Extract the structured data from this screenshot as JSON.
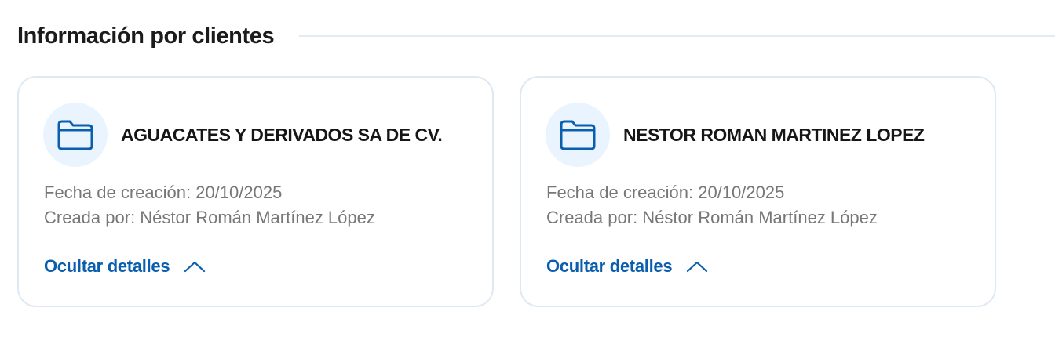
{
  "section": {
    "title": "Información por clientes"
  },
  "cards": [
    {
      "name": "AGUACATES Y DERIVADOS SA DE CV.",
      "created_line": "Fecha de creación: 20/10/2025",
      "author_line": "Creada por: Néstor Román Martínez López",
      "toggle_label": "Ocultar detalles",
      "icon": "folder-icon",
      "toggle_icon": "chevron-up-icon"
    },
    {
      "name": "NESTOR ROMAN MARTINEZ LOPEZ",
      "created_line": "Fecha de creación: 20/10/2025",
      "author_line": "Creada por: Néstor Román Martínez López",
      "toggle_label": "Ocultar detalles",
      "icon": "folder-icon",
      "toggle_icon": "chevron-up-icon"
    }
  ],
  "colors": {
    "accent": "#0a5eae",
    "folder_bg": "#eaf4ff",
    "card_border": "#dfe9f4",
    "meta_text": "#777777"
  }
}
